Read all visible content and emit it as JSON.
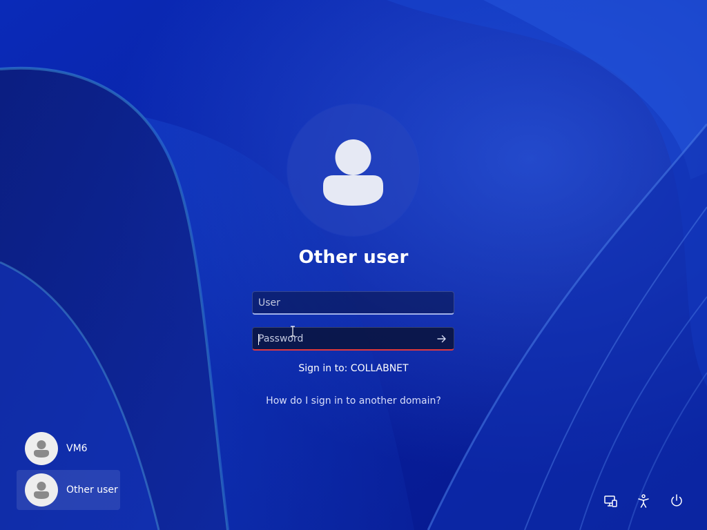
{
  "login": {
    "selected_user": "Other user",
    "user_placeholder": "User",
    "password_placeholder": "Password",
    "sign_in_to": "Sign in to: COLLABNET",
    "domain_help": "How do I sign in to another domain?"
  },
  "user_switcher": [
    {
      "label": "VM6",
      "selected": false
    },
    {
      "label": "Other user",
      "selected": true
    }
  ],
  "corner_icons": [
    "network-icon",
    "accessibility-icon",
    "power-icon"
  ],
  "colors": {
    "wallpaper_base": "#0a1fa8",
    "password_underline": "#e0393e",
    "text": "#ffffff"
  }
}
